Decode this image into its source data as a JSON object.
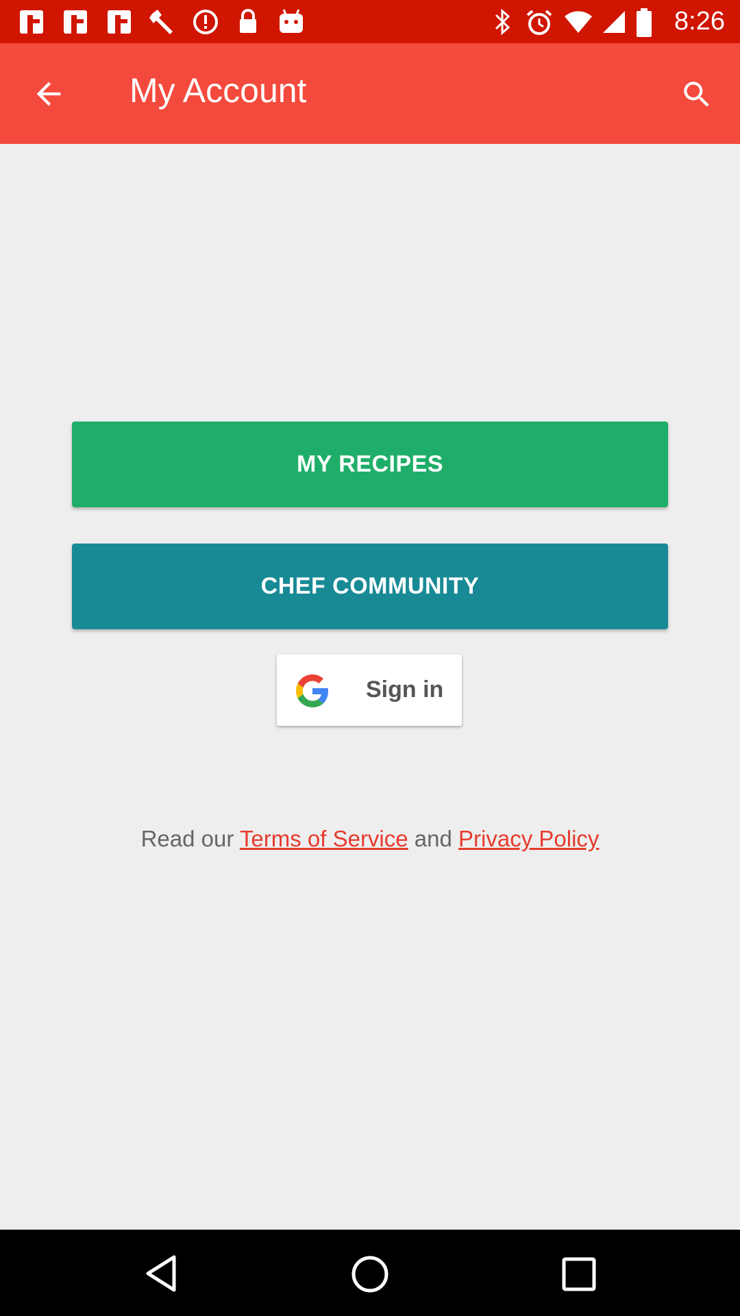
{
  "status_bar": {
    "time": "8:26",
    "left_icons": [
      "notification-app-icon",
      "notification-app-icon",
      "notification-app-icon",
      "wrench-icon",
      "alert-icon",
      "lock-icon",
      "android-icon"
    ],
    "right_icons": [
      "bluetooth-icon",
      "alarm-icon",
      "wifi-icon",
      "signal-icon",
      "battery-icon"
    ]
  },
  "app_bar": {
    "title": "My Account",
    "back_icon": "arrow-back-icon",
    "search_icon": "search-icon"
  },
  "buttons": {
    "my_recipes": "MY RECIPES",
    "chef_community": "CHEF COMMUNITY",
    "sign_in": "Sign in"
  },
  "terms": {
    "prefix": "Read our ",
    "terms_link": "Terms of Service",
    "middle": " and ",
    "privacy_link": "Privacy Policy"
  },
  "colors": {
    "status_bar": "#d01500",
    "app_bar": "#f44a3d",
    "my_recipes": "#1fae6a",
    "chef_community": "#188a96",
    "link": "#e63b2e"
  },
  "nav_bar": {
    "icons": [
      "back-triangle-icon",
      "home-circle-icon",
      "recents-square-icon"
    ]
  }
}
